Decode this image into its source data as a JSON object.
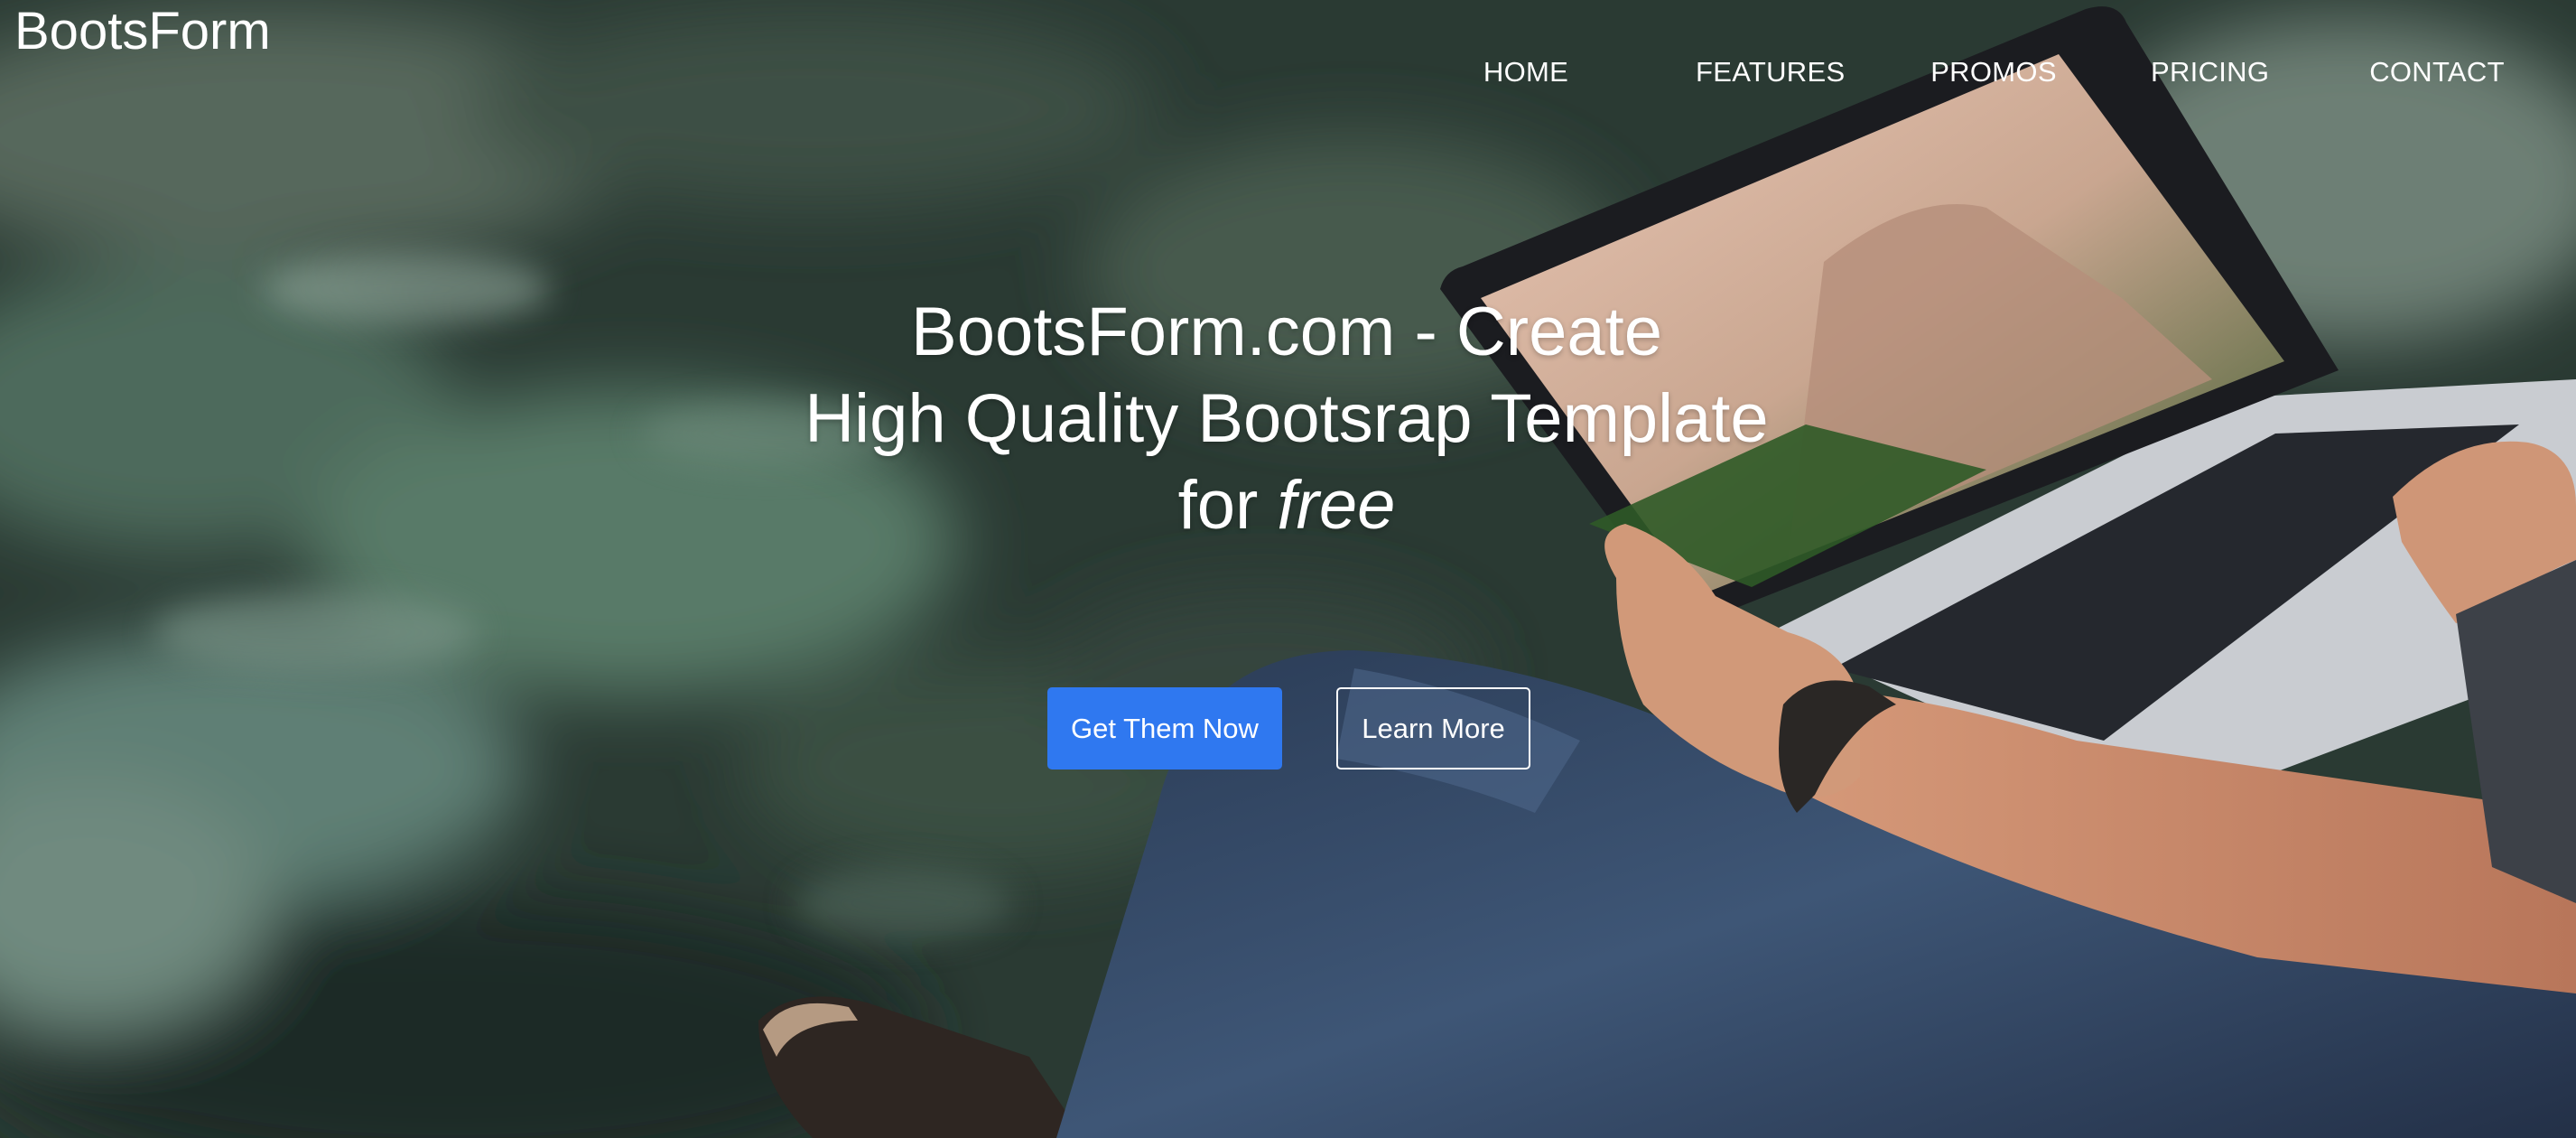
{
  "brand": "BootsForm",
  "nav": {
    "home": "HOME",
    "features": "FEATURES",
    "promos": "PROMOS",
    "pricing": "PRICING",
    "contact": "CONTACT"
  },
  "hero": {
    "line1": "BootsForm.com - Create",
    "line2": "High Quality Bootsrap Template",
    "line3_prefix": "for ",
    "line3_em": "free",
    "primary_button": "Get Them Now",
    "secondary_button": "Learn More",
    "background_image": "photo of person sitting on rock with laptop"
  },
  "colors": {
    "primary": "#2f78f0",
    "text": "#ffffff"
  }
}
